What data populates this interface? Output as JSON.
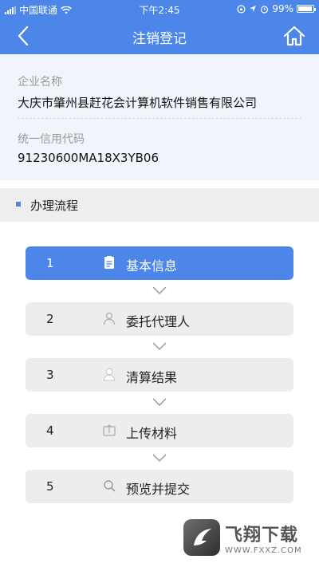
{
  "status_bar": {
    "carrier": "中国联通",
    "time": "下午2:45",
    "battery": "99%"
  },
  "nav": {
    "title": "注销登记",
    "back_icon": "chevron-left-icon",
    "home_icon": "home-icon"
  },
  "company": {
    "name_label": "企业名称",
    "name_value": "大庆市肇州县赶花会计算机软件销售有限公司",
    "credit_label": "统一信用代码",
    "credit_value": "91230600MA18X3YB06"
  },
  "section": {
    "title": "办理流程"
  },
  "steps": [
    {
      "num": "1",
      "label": "基本信息",
      "icon": "document-icon",
      "active": true
    },
    {
      "num": "2",
      "label": "委托代理人",
      "icon": "person-outline-icon",
      "active": false
    },
    {
      "num": "3",
      "label": "清算结果",
      "icon": "person-icon",
      "active": false
    },
    {
      "num": "4",
      "label": "上传材料",
      "icon": "upload-icon",
      "active": false
    },
    {
      "num": "5",
      "label": "预览并提交",
      "icon": "search-icon",
      "active": false
    }
  ],
  "watermark": {
    "brand": "飞翔下载",
    "url": "WWW.FXXZ.COM"
  },
  "colors": {
    "primary": "#4b86e8",
    "step_bg": "#ededed",
    "section_bg": "#eeeeee",
    "info_bg": "#f1f5fb"
  }
}
